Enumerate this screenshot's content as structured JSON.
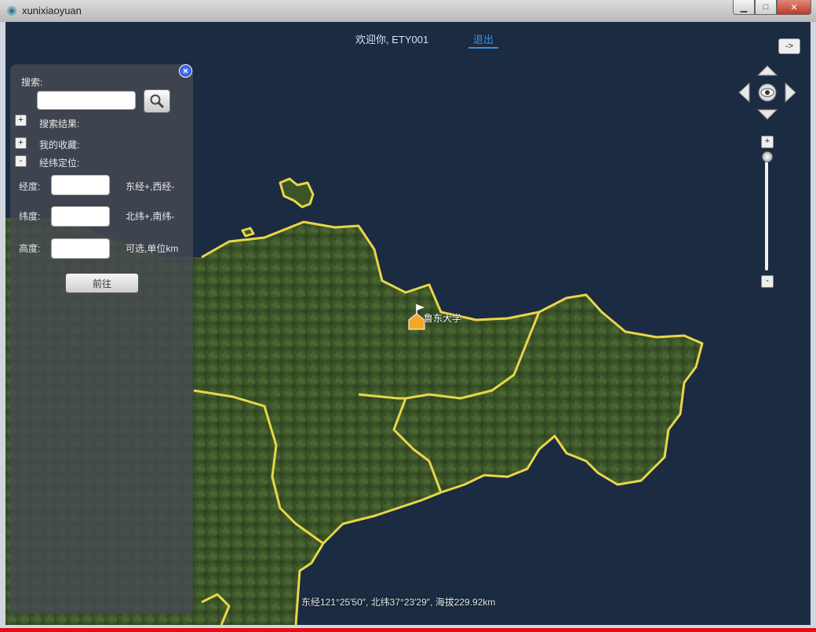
{
  "window": {
    "title": "xunixiaoyuan",
    "minimize": "▁",
    "maximize": "□",
    "close": "✕"
  },
  "header": {
    "welcome": "欢迎你, ETY001",
    "logout": "退出",
    "toggle": "->"
  },
  "panel": {
    "search_label": "搜索:",
    "search_value": "",
    "results_label": "搜索结果:",
    "favorites_label": "我的收藏:",
    "locate_label": "经纬定位:",
    "expand_plus": "+",
    "expand_minus": "-",
    "lon_label": "经度:",
    "lon_hint": "东经+,西经-",
    "lat_label": "纬度:",
    "lat_hint": "北纬+,南纬-",
    "alt_label": "高度:",
    "alt_hint": "可选,单位km",
    "go_button": "前往"
  },
  "map": {
    "marker_label": "鲁东大学",
    "coords": "东经121°25′50″, 北纬37°23′29″, 海拔229.92km"
  },
  "zoom": {
    "plus": "+",
    "minus": "-",
    "level": 0.0
  },
  "colors": {
    "sea": "#1b2b42",
    "land": "#3e5a2c",
    "border": "#e8d64a",
    "panel": "#464a52",
    "accent": "#3a8fe0"
  }
}
